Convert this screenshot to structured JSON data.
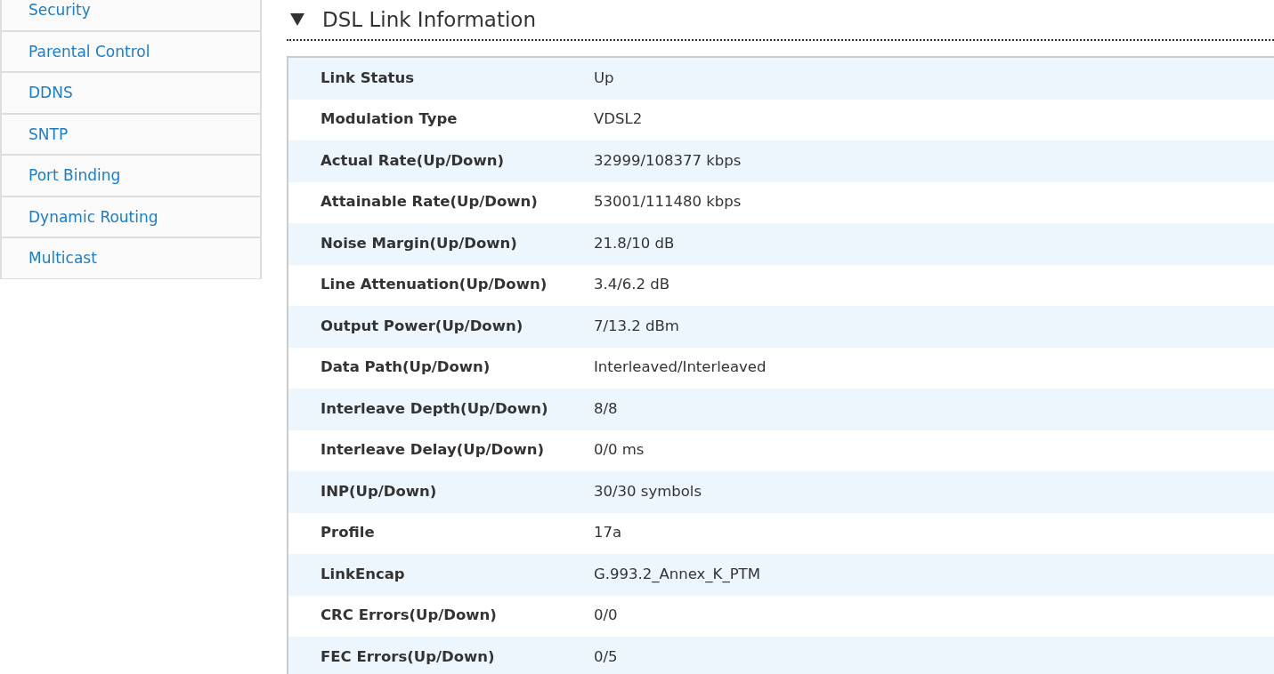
{
  "sidebar": {
    "items": [
      {
        "label": "Security"
      },
      {
        "label": "Parental Control"
      },
      {
        "label": "DDNS"
      },
      {
        "label": "SNTP"
      },
      {
        "label": "Port Binding"
      },
      {
        "label": "Dynamic Routing"
      },
      {
        "label": "Multicast"
      }
    ]
  },
  "section": {
    "title": "DSL Link Information",
    "expanded": true,
    "rows": [
      {
        "label": "Link Status",
        "value": "Up"
      },
      {
        "label": "Modulation Type",
        "value": "VDSL2"
      },
      {
        "label": "Actual Rate(Up/Down)",
        "value": "32999/108377 kbps"
      },
      {
        "label": "Attainable Rate(Up/Down)",
        "value": "53001/111480 kbps"
      },
      {
        "label": "Noise Margin(Up/Down)",
        "value": "21.8/10 dB"
      },
      {
        "label": "Line Attenuation(Up/Down)",
        "value": "3.4/6.2 dB"
      },
      {
        "label": "Output Power(Up/Down)",
        "value": "7/13.2 dBm"
      },
      {
        "label": "Data Path(Up/Down)",
        "value": "Interleaved/Interleaved"
      },
      {
        "label": "Interleave Depth(Up/Down)",
        "value": "8/8"
      },
      {
        "label": "Interleave Delay(Up/Down)",
        "value": "0/0 ms"
      },
      {
        "label": "INP(Up/Down)",
        "value": "30/30 symbols"
      },
      {
        "label": "Profile",
        "value": "17a"
      },
      {
        "label": "LinkEncap",
        "value": "G.993.2_Annex_K_PTM"
      },
      {
        "label": "CRC Errors(Up/Down)",
        "value": "0/0"
      },
      {
        "label": "FEC Errors(Up/Down)",
        "value": "0/5"
      }
    ]
  }
}
